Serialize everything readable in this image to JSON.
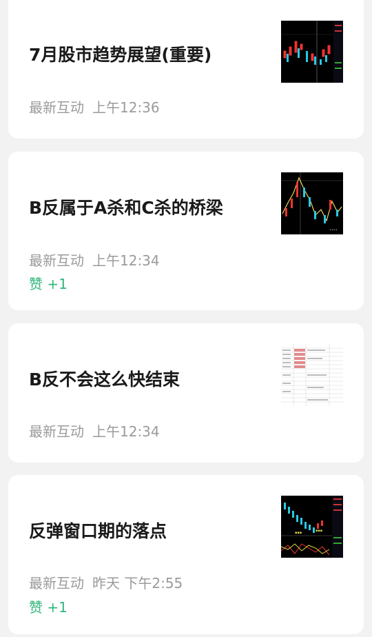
{
  "posts": [
    {
      "title": "7月股市趋势展望(重要)",
      "meta_label": "最新互动",
      "time": "上午12:36",
      "likes": "",
      "thumb_icon": "stock-chart-thumbnail"
    },
    {
      "title": "B反属于A杀和C杀的桥梁",
      "meta_label": "最新互动",
      "time": "上午12:34",
      "likes": "赞 +1",
      "thumb_icon": "stock-chart-thumbnail"
    },
    {
      "title": "B反不会这么快结束",
      "meta_label": "最新互动",
      "time": "上午12:34",
      "likes": "",
      "thumb_icon": "spreadsheet-thumbnail"
    },
    {
      "title": "反弹窗口期的落点",
      "meta_label": "最新互动",
      "time": "昨天 下午2:55",
      "likes": "赞 +1",
      "thumb_icon": "stock-chart-thumbnail"
    }
  ],
  "colors": {
    "background": "#f2f2f2",
    "card": "#ffffff",
    "title": "#1a1a1a",
    "meta": "#9a9a9a",
    "like": "#2fb67a"
  }
}
